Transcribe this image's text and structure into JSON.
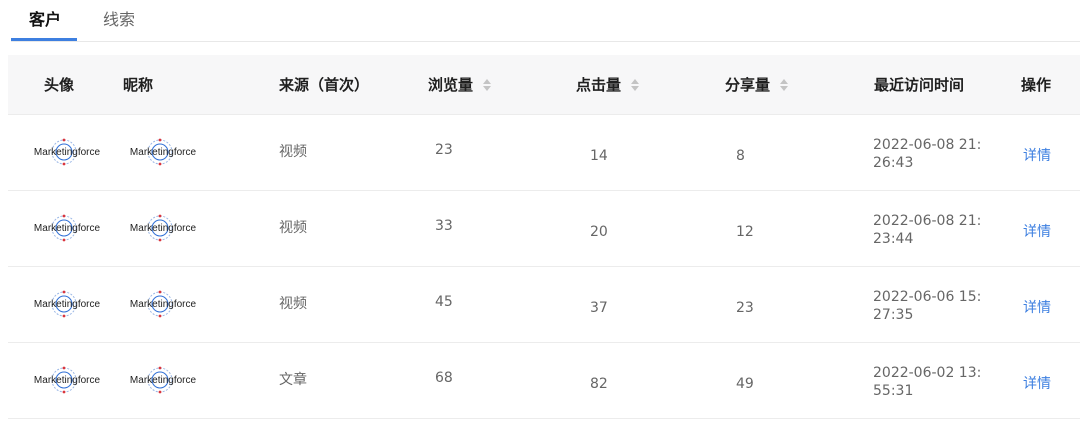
{
  "tabs": [
    {
      "label": "客户",
      "active": true
    },
    {
      "label": "线索",
      "active": false
    }
  ],
  "columns": {
    "avatar": "头像",
    "nickname": "昵称",
    "source": "来源（首次）",
    "views": "浏览量",
    "clicks": "点击量",
    "shares": "分享量",
    "recent_visit": "最近访问时间",
    "actions": "操作"
  },
  "logo_text": "Marketingforce",
  "rows": [
    {
      "source": "视频",
      "views": "23",
      "clicks": "14",
      "shares": "8",
      "time_line1": "2022-06-08 21:",
      "time_line2": "26:43",
      "action": "详情"
    },
    {
      "source": "视频",
      "views": "33",
      "clicks": "20",
      "shares": "12",
      "time_line1": "2022-06-08 21:",
      "time_line2": "23:44",
      "action": "详情"
    },
    {
      "source": "视频",
      "views": "45",
      "clicks": "37",
      "shares": "23",
      "time_line1": "2022-06-06 15:",
      "time_line2": "27:35",
      "action": "详情"
    },
    {
      "source": "文章",
      "views": "68",
      "clicks": "82",
      "shares": "49",
      "time_line1": "2022-06-02 13:",
      "time_line2": "55:31",
      "action": "详情"
    }
  ],
  "colors": {
    "accent": "#3d7fe0",
    "header_bg": "#f7f7f8",
    "divider": "#ececec",
    "logo_red": "#d9363e",
    "logo_blue": "#2f6fd6"
  }
}
